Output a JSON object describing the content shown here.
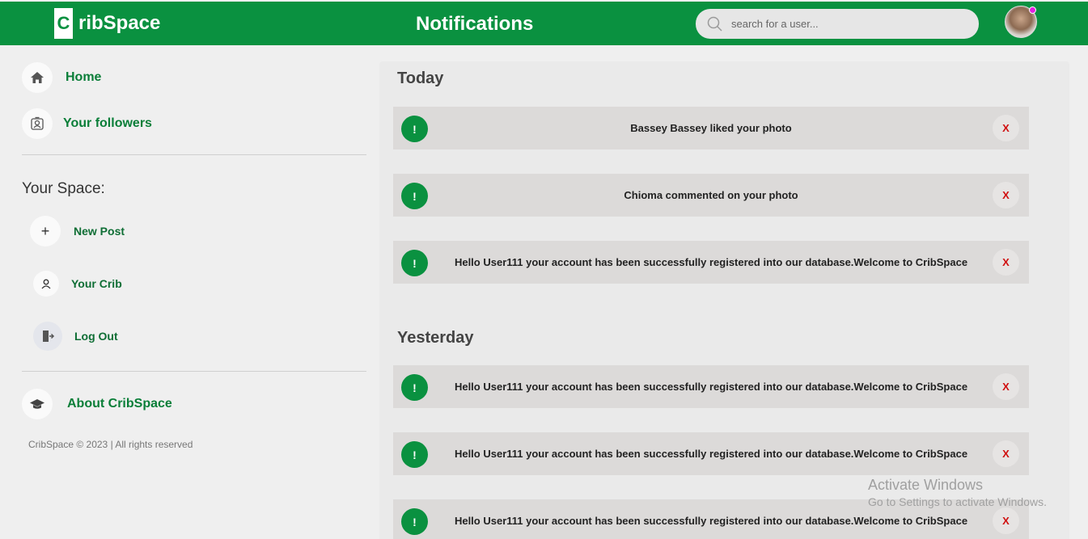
{
  "brand": {
    "initial": "C",
    "name": "ribSpace"
  },
  "header": {
    "title": "Notifications"
  },
  "search": {
    "placeholder": "search for a user..."
  },
  "sidebar": {
    "home": "Home",
    "followers": "Your followers",
    "section_title": "Your Space:",
    "new_post": "New Post",
    "your_crib": "Your Crib",
    "log_out": "Log Out",
    "about": "About CribSpace",
    "footer": "CribSpace © 2023 | All rights reserved"
  },
  "notifications": {
    "today_label": "Today",
    "yesterday_label": "Yesterday",
    "today": [
      {
        "icon": "!",
        "text": "Bassey Bassey liked your photo",
        "close": "X"
      },
      {
        "icon": "!",
        "text": "Chioma commented on your photo",
        "close": "X"
      },
      {
        "icon": "!",
        "text": "Hello User111 your account has been successfully registered into our database.Welcome to CribSpace",
        "close": "X"
      }
    ],
    "yesterday": [
      {
        "icon": "!",
        "text": "Hello User111 your account has been successfully registered into our database.Welcome to CribSpace",
        "close": "X"
      },
      {
        "icon": "!",
        "text": "Hello User111 your account has been successfully registered into our database.Welcome to CribSpace",
        "close": "X"
      },
      {
        "icon": "!",
        "text": "Hello User111 your account has been successfully registered into our database.Welcome to CribSpace",
        "close": "X"
      }
    ]
  },
  "watermark": {
    "line1": "Activate Windows",
    "line2": "Go to Settings to activate Windows."
  },
  "colors": {
    "brand_green": "#0a9140",
    "close_red": "#d01010",
    "status_dot": "#e020e0"
  }
}
